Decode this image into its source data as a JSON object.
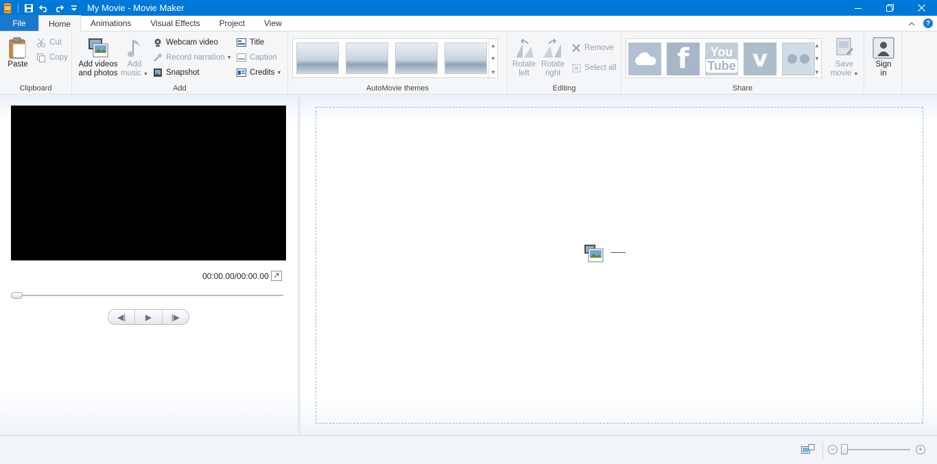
{
  "window": {
    "title": "My Movie - Movie Maker"
  },
  "quick_access": {
    "icons": [
      "app-icon",
      "save-icon",
      "undo-icon",
      "redo-icon",
      "customize-icon"
    ]
  },
  "tabs": [
    {
      "label": "File"
    },
    {
      "label": "Home",
      "active": true
    },
    {
      "label": "Animations"
    },
    {
      "label": "Visual Effects"
    },
    {
      "label": "Project"
    },
    {
      "label": "View"
    }
  ],
  "help": {
    "label": "?"
  },
  "ribbon": {
    "clipboard": {
      "label": "Clipboard",
      "paste": "Paste",
      "cut": "Cut",
      "copy": "Copy"
    },
    "add": {
      "label": "Add",
      "add_videos_line1": "Add videos",
      "add_videos_line2": "and photos",
      "add_music_line1": "Add",
      "add_music_line2": "music",
      "webcam": "Webcam video",
      "record": "Record narration",
      "snapshot": "Snapshot",
      "title": "Title",
      "caption": "Caption",
      "credits": "Credits"
    },
    "themes": {
      "label": "AutoMovie themes",
      "count": 4
    },
    "editing": {
      "label": "Editing",
      "rotate_left_1": "Rotate",
      "rotate_left_2": "left",
      "rotate_right_1": "Rotate",
      "rotate_right_2": "right",
      "remove": "Remove",
      "select_all": "Select all"
    },
    "share": {
      "label": "Share",
      "services": [
        "onedrive-icon",
        "facebook-icon",
        "youtube-icon",
        "vimeo-icon",
        "flickr-icon"
      ],
      "youtube_top": "You",
      "youtube_bottom": "Tube",
      "save_movie_1": "Save",
      "save_movie_2": "movie",
      "sign_in_1": "Sign",
      "sign_in_2": "in"
    }
  },
  "preview": {
    "timecode": "00:00.00/00:00.00"
  },
  "player": {
    "prev": "◀|",
    "play": "▶",
    "next": "|▶"
  },
  "zoom": {
    "minus": "−",
    "plus": "+"
  },
  "colors": {
    "titlebar": "#0078d7",
    "file_tab": "#1979ca",
    "storyboard_border": "#8fb8dd"
  }
}
